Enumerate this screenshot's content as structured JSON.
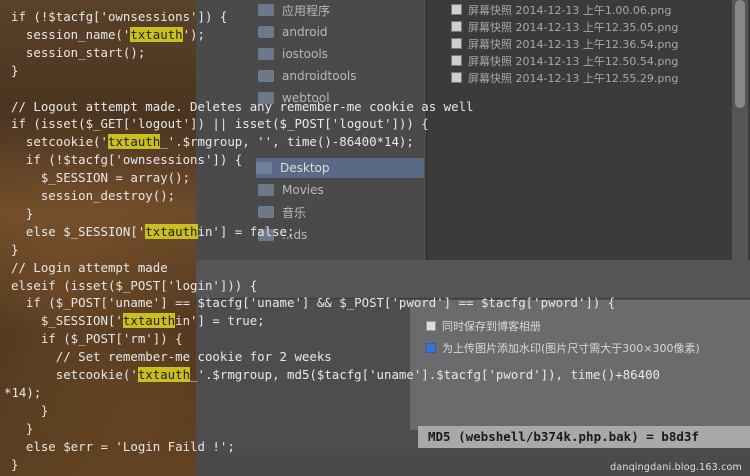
{
  "finder": {
    "sidebar": [
      {
        "label": "应用程序",
        "icon": "applications-icon"
      },
      {
        "label": "android",
        "icon": "folder-icon"
      },
      {
        "label": "iostools",
        "icon": "folder-icon"
      },
      {
        "label": "androidtools",
        "icon": "folder-icon"
      },
      {
        "label": "webtool",
        "icon": "folder-icon"
      },
      {
        "label": "Movies",
        "icon": "movies-icon"
      },
      {
        "label": "音乐",
        "icon": "music-icon"
      },
      {
        "label": "...ds",
        "icon": "downloads-icon"
      }
    ],
    "selected_item": "Desktop",
    "files": [
      "屏幕快照 2014-12-13 上午1.00.06.png",
      "屏幕快照 2014-12-13 上午12.35.05.png",
      "屏幕快照 2014-12-13 上午12.36.54.png",
      "屏幕快照 2014-12-13 上午12.50.54.png",
      "屏幕快照 2014-12-13 上午12.55.29.png"
    ]
  },
  "dialog": {
    "option_save": "同时保存到博客相册",
    "option_watermark": "为上传图片添加水印(图片尺寸需大于300×300像素)",
    "md5_text": "MD5 (webshell/b374k.php.bak) = b8d3f"
  },
  "watermark": "danqingdani.blog.163.com",
  "code": {
    "l1a": "if (!$tacfg['ownsessions']) {",
    "l2a": "  session_name('",
    "l2h": "txtauth",
    "l2b": "');",
    "l3a": "  session_start();",
    "l4a": "}",
    "l5a": "",
    "l6a": "// Logout attempt made. Deletes any remember-me cookie as well",
    "l7a": "if (isset($_GET['logout']) || isset($_POST['logout'])) {",
    "l8a": "  setcookie('",
    "l8h": "txtauth",
    "l8b": "_'.$rmgroup, '', time()-86400*14);",
    "l9a": "  if (!$tacfg['ownsessions']) {",
    "l10a": "    $_SESSION = array();",
    "l11a": "    session_destroy();",
    "l12a": "  }",
    "l13a": "  else $_SESSION['",
    "l13h": "txtauth",
    "l13b": "in'] = false;",
    "l14a": "}",
    "l15a": "// Login attempt made",
    "l16a": "elseif (isset($_POST['login'])) {",
    "l17a": "  if ($_POST['uname'] == $tacfg['uname'] && $_POST['pword'] == $tacfg['pword']) {",
    "l18a": "    $_SESSION['",
    "l18h": "txtauth",
    "l18b": "in'] = true;",
    "l19a": "    if ($_POST['rm']) {",
    "l20a": "      // Set remember-me cookie for 2 weeks",
    "l21a": "      setcookie('",
    "l21h": "txtauth",
    "l21b": "_'.$rmgroup, md5($tacfg['uname'].$tacfg['pword']), time()+86400",
    "l22a": "*14);",
    "l23a": "    }",
    "l24a": "  }",
    "l25a": "  else $err = 'Login Faild !';",
    "l26a": "}"
  }
}
